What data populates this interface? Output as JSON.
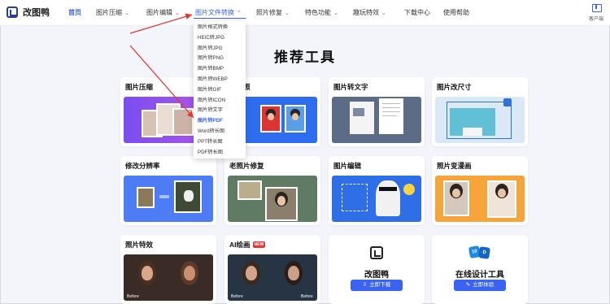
{
  "brand": {
    "name": "改图鸭"
  },
  "nav": {
    "home": "首页",
    "compress": "图片压缩",
    "edit": "图片编辑",
    "convert": "图片文件转换",
    "restore": "照片修复",
    "features": "特色功能",
    "fun": "趣玩特效",
    "download": "下载中心",
    "help": "使用帮助"
  },
  "client": {
    "label": "客户端"
  },
  "dropdown": {
    "items": [
      "图片格式转换",
      "HEIC转JPG",
      "图片转JPG",
      "图片转PNG",
      "图片转BMP",
      "图片转WEBP",
      "图片转GIF",
      "图片转ICON",
      "图片转文字",
      "图片转PDF",
      "Word转长图",
      "PPT转长图",
      "PDF转长图"
    ]
  },
  "page_title": "推荐工具",
  "cards": {
    "compress": "图片压缩",
    "idphoto": "证件照",
    "ocr": "图片转文字",
    "resize": "图片改尺寸",
    "dpi": "修改分辨率",
    "restore": "老照片修复",
    "edit": "图片编辑",
    "cartoon": "照片变漫画",
    "effect": "照片特效",
    "ai": "AI绘画",
    "ai_badge": "NEW"
  },
  "before_label": "Before",
  "promo": {
    "app_title": "改图鸭",
    "app_button": "立即下载",
    "design_title": "在线设计工具",
    "design_button": "立即体验"
  },
  "colors": {
    "accent": "#3b63f2",
    "annotation": "#e53935"
  }
}
